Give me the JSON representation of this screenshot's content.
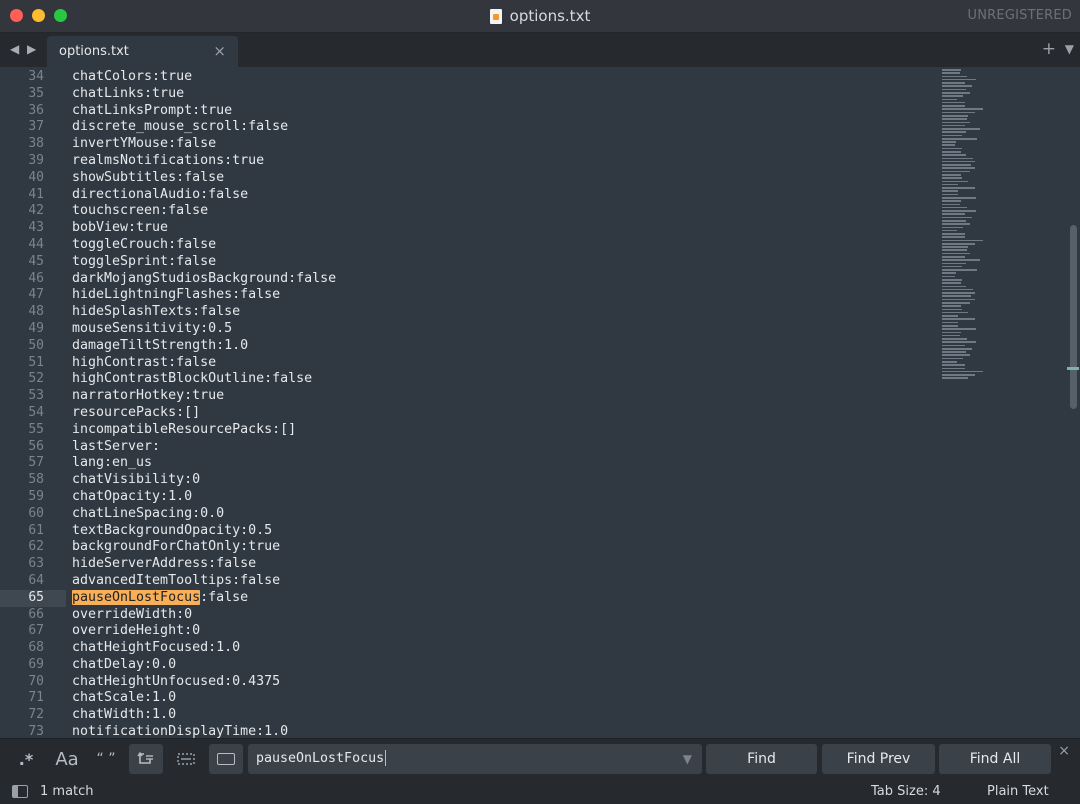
{
  "window": {
    "title": "options.txt",
    "unregistered": "UNREGISTERED",
    "icons": [
      "close-dot",
      "minimize-dot",
      "zoom-dot",
      "text-file-icon"
    ]
  },
  "tabs": {
    "nav_arrows": "◀ ▶",
    "active": {
      "label": "options.txt",
      "close": "×"
    },
    "new_tab": "+",
    "dropdown": "▼"
  },
  "editor": {
    "current_line": 65,
    "highlight_color": "#f9ae58",
    "lines": [
      {
        "n": "34",
        "pre": "chatColors:true",
        "match": "",
        "post": ""
      },
      {
        "n": "35",
        "pre": "chatLinks:true",
        "match": "",
        "post": ""
      },
      {
        "n": "36",
        "pre": "chatLinksPrompt:true",
        "match": "",
        "post": ""
      },
      {
        "n": "37",
        "pre": "discrete_mouse_scroll:false",
        "match": "",
        "post": ""
      },
      {
        "n": "38",
        "pre": "invertYMouse:false",
        "match": "",
        "post": ""
      },
      {
        "n": "39",
        "pre": "realmsNotifications:true",
        "match": "",
        "post": ""
      },
      {
        "n": "40",
        "pre": "showSubtitles:false",
        "match": "",
        "post": ""
      },
      {
        "n": "41",
        "pre": "directionalAudio:false",
        "match": "",
        "post": ""
      },
      {
        "n": "42",
        "pre": "touchscreen:false",
        "match": "",
        "post": ""
      },
      {
        "n": "43",
        "pre": "bobView:true",
        "match": "",
        "post": ""
      },
      {
        "n": "44",
        "pre": "toggleCrouch:false",
        "match": "",
        "post": ""
      },
      {
        "n": "45",
        "pre": "toggleSprint:false",
        "match": "",
        "post": ""
      },
      {
        "n": "46",
        "pre": "darkMojangStudiosBackground:false",
        "match": "",
        "post": ""
      },
      {
        "n": "47",
        "pre": "hideLightningFlashes:false",
        "match": "",
        "post": ""
      },
      {
        "n": "48",
        "pre": "hideSplashTexts:false",
        "match": "",
        "post": ""
      },
      {
        "n": "49",
        "pre": "mouseSensitivity:0.5",
        "match": "",
        "post": ""
      },
      {
        "n": "50",
        "pre": "damageTiltStrength:1.0",
        "match": "",
        "post": ""
      },
      {
        "n": "51",
        "pre": "highContrast:false",
        "match": "",
        "post": ""
      },
      {
        "n": "52",
        "pre": "highContrastBlockOutline:false",
        "match": "",
        "post": ""
      },
      {
        "n": "53",
        "pre": "narratorHotkey:true",
        "match": "",
        "post": ""
      },
      {
        "n": "54",
        "pre": "resourcePacks:[]",
        "match": "",
        "post": ""
      },
      {
        "n": "55",
        "pre": "incompatibleResourcePacks:[]",
        "match": "",
        "post": ""
      },
      {
        "n": "56",
        "pre": "lastServer:",
        "match": "",
        "post": ""
      },
      {
        "n": "57",
        "pre": "lang:en_us",
        "match": "",
        "post": ""
      },
      {
        "n": "58",
        "pre": "chatVisibility:0",
        "match": "",
        "post": ""
      },
      {
        "n": "59",
        "pre": "chatOpacity:1.0",
        "match": "",
        "post": ""
      },
      {
        "n": "60",
        "pre": "chatLineSpacing:0.0",
        "match": "",
        "post": ""
      },
      {
        "n": "61",
        "pre": "textBackgroundOpacity:0.5",
        "match": "",
        "post": ""
      },
      {
        "n": "62",
        "pre": "backgroundForChatOnly:true",
        "match": "",
        "post": ""
      },
      {
        "n": "63",
        "pre": "hideServerAddress:false",
        "match": "",
        "post": ""
      },
      {
        "n": "64",
        "pre": "advancedItemTooltips:false",
        "match": "",
        "post": ""
      },
      {
        "n": "65",
        "pre": "",
        "match": "pauseOnLostFocus",
        "post": ":false"
      },
      {
        "n": "66",
        "pre": "overrideWidth:0",
        "match": "",
        "post": ""
      },
      {
        "n": "67",
        "pre": "overrideHeight:0",
        "match": "",
        "post": ""
      },
      {
        "n": "68",
        "pre": "chatHeightFocused:1.0",
        "match": "",
        "post": ""
      },
      {
        "n": "69",
        "pre": "chatDelay:0.0",
        "match": "",
        "post": ""
      },
      {
        "n": "70",
        "pre": "chatHeightUnfocused:0.4375",
        "match": "",
        "post": ""
      },
      {
        "n": "71",
        "pre": "chatScale:1.0",
        "match": "",
        "post": ""
      },
      {
        "n": "72",
        "pre": "chatWidth:1.0",
        "match": "",
        "post": ""
      },
      {
        "n": "73",
        "pre": "notificationDisplayTime:1.0",
        "match": "",
        "post": ""
      }
    ]
  },
  "find": {
    "regex": ".*",
    "case": "Aa",
    "whole_word": "“ ”",
    "wrap_icon": "wrap-icon",
    "in_selection_icon": "in-selection-icon",
    "highlight_icon": "highlight-matches-icon",
    "query": "pauseOnLostFocus",
    "dropdown": "▼",
    "find_label": "Find",
    "find_prev_label": "Find Prev",
    "find_all_label": "Find All",
    "close": "×"
  },
  "status": {
    "message": "1 match",
    "tab_size": "Tab Size: 4",
    "syntax": "Plain Text"
  }
}
